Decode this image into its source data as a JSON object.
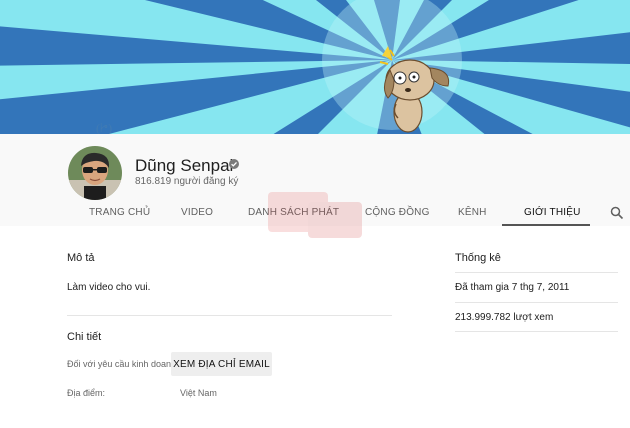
{
  "channel": {
    "name": "Dũng Senpai",
    "subscribers": "816.819 người đăng ký"
  },
  "tabs": [
    {
      "label": "TRANG CHỦ"
    },
    {
      "label": "VIDEO"
    },
    {
      "label": "DANH SÁCH PHÁT"
    },
    {
      "label": "CỘNG ĐỒNG"
    },
    {
      "label": "KÊNH"
    },
    {
      "label": "GIỚI THIỆU",
      "active": true
    }
  ],
  "about": {
    "description_title": "Mô tả",
    "description_text": "Làm video cho vui.",
    "details_title": "Chi tiết",
    "business_label": "Đối với yêu cầu kinh doanh:",
    "email_button": "XEM ĐỊA CHỈ EMAIL",
    "location_label": "Địa điểm:",
    "location_value": "Việt Nam"
  },
  "stats": {
    "title": "Thống kê",
    "joined": "Đã tham gia 7 thg 7, 2011",
    "views": "213.999.782 lượt xem"
  },
  "icons": {
    "search": "search-icon",
    "verified": "verified-check-icon"
  },
  "colors": {
    "banner_sky": "#7fe3ef",
    "banner_ray": "#2a6fb3",
    "header_bg": "#f9f9f9",
    "tab_underline": "#555555",
    "button_bg": "#eeeeee"
  }
}
